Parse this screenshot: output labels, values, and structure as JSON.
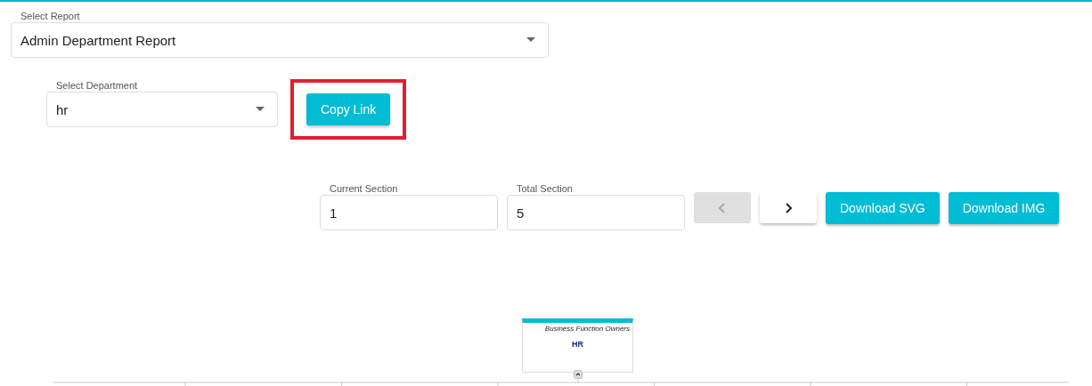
{
  "report_select": {
    "label": "Select Report",
    "value": "Admin Department Report"
  },
  "department_select": {
    "label": "Select Department",
    "value": "hr"
  },
  "copy_link": {
    "label": "Copy Link",
    "highlighted": true
  },
  "sections": {
    "current": {
      "label": "Current Section",
      "value": "1"
    },
    "total": {
      "label": "Total Section",
      "value": "5"
    },
    "prev": {
      "disabled": true
    },
    "next": {
      "disabled": false
    }
  },
  "downloads": [
    "Download SVG",
    "Download IMG"
  ],
  "org_chart": {
    "node": {
      "subtitle": "Business Function Owners",
      "title": "HR",
      "expanded": true
    }
  }
}
